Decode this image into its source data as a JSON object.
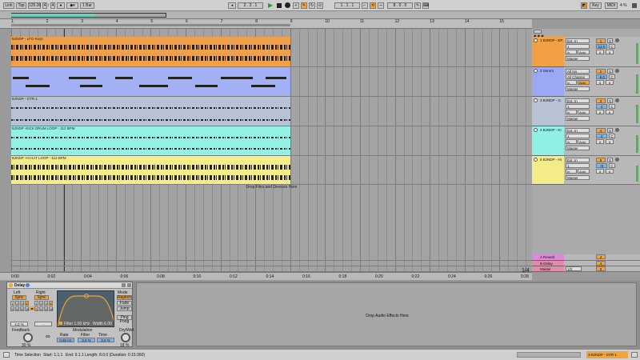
{
  "transport": {
    "link": "Link",
    "tap": "Tap",
    "tempo": "125.00",
    "sig_num": "4",
    "sig_den": "4",
    "quantize": "1 Bar",
    "position": "2 . 3 . 1",
    "loop_start": "1 . 1 . 1",
    "loop_len": "8 . 0 . 0",
    "key": "Key",
    "midi": "MIDI",
    "cpu": "4 %"
  },
  "ruler": {
    "bars": [
      "1",
      "2",
      "3",
      "4",
      "5",
      "6",
      "7",
      "8",
      "9",
      "10",
      "11",
      "12",
      "13",
      "14",
      "15"
    ]
  },
  "timeline": {
    "times": [
      "0:00",
      "0:02",
      "0:04",
      "0:06",
      "0:08",
      "0:10",
      "0:12",
      "0:14",
      "0:16",
      "0:18",
      "0:20",
      "0:22",
      "0:24",
      "0:26",
      "0:28"
    ],
    "zoom": "1/4"
  },
  "tracks": [
    {
      "clip": "BJNDP - LFO Keys",
      "name": "1 BJNDP - EP",
      "input": "Ext. In",
      "ch": "1",
      "out": "Master",
      "vol": "12.0",
      "pan": "C",
      "color": "#f2a044",
      "clipcolor": "#f0a04a",
      "kind": "audio"
    },
    {
      "clip": "",
      "name": "2 Serum",
      "input": "All Ins",
      "ch": "All Channe",
      "out": "Master",
      "vol": "-6.0",
      "pan": "C",
      "color": "#9aa8f5",
      "clipcolor": "#a3b0f5",
      "kind": "midi"
    },
    {
      "clip": "BJNDP - GTR 1",
      "name": "3 BJNDP - G",
      "input": "Ext. In",
      "ch": "1",
      "out": "Master",
      "vol": "4",
      "pan": "C",
      "color": "#b8c3d6",
      "clipcolor": "#b7c2d4",
      "kind": "audio"
    },
    {
      "clip": "BJNDP -KICK DRUM LOOP - 112 BPM",
      "name": "4 BJNDP - KI",
      "input": "Ext. In",
      "ch": "1",
      "out": "Master",
      "vol": "4",
      "pan": "C",
      "color": "#8ff0e3",
      "clipcolor": "#93f1e4",
      "kind": "audio"
    },
    {
      "clip": "BJNDP -HI HAT LOOP - 112 BPM",
      "name": "5 BJNDP - HI",
      "input": "Ext. In",
      "ch": "1",
      "out": "Master",
      "vol": "-6",
      "pan": "C",
      "color": "#f4ec88",
      "clipcolor": "#f5ec8a",
      "kind": "audio"
    }
  ],
  "drop_files_text": "Drop Files and Devices Here",
  "returns": [
    {
      "name": "A Reverb",
      "color": "#d98ad8",
      "vol": "4"
    },
    {
      "name": "B Delay",
      "color": "#e58aa8",
      "vol": "4"
    },
    {
      "name": "Master",
      "color": "#e58aa8",
      "vol": "0",
      "out": "1/2"
    }
  ],
  "delay_device": {
    "title": "Delay",
    "left_label": "Left",
    "right_label": "Right",
    "mode_label": "Mode",
    "sync": "Sync",
    "left_steps": [
      "1",
      "2",
      "3",
      "4",
      "5",
      "6",
      "8",
      "16"
    ],
    "right_steps": [
      "1",
      "2",
      "3",
      "4",
      "5",
      "6",
      "8",
      "16"
    ],
    "left_val": "4.0 %",
    "right_val": "-",
    "filter_freq": "Filter  1.00 kHz",
    "filter_width": "Width  6.00",
    "modulation": "Modulation",
    "rate_label": "Rate",
    "rate_val": "0.50 Hz",
    "filt_label": "Filter",
    "filt_val": "0.0 %",
    "time_label": "Time",
    "time_val": "0.0 %",
    "mode_repitch": "Repitch",
    "mode_fade": "Fade",
    "mode_jump": "Jump",
    "ping_pong": "Ping Pong",
    "feedback_label": "Feedback",
    "feedback_val": "30 %",
    "drywet_label": "Dry/Wet",
    "drywet_val": "18 %"
  },
  "drop_effects_text": "Drop Audio Effects Here",
  "status": {
    "mode": "Time Selection",
    "start": "Start: 1.1.1",
    "end": "End: 9.1.1",
    "length": "Length: 8.0.0  (Duration: 0:15:360)",
    "track": "3-BJNDP - GTR 1"
  }
}
